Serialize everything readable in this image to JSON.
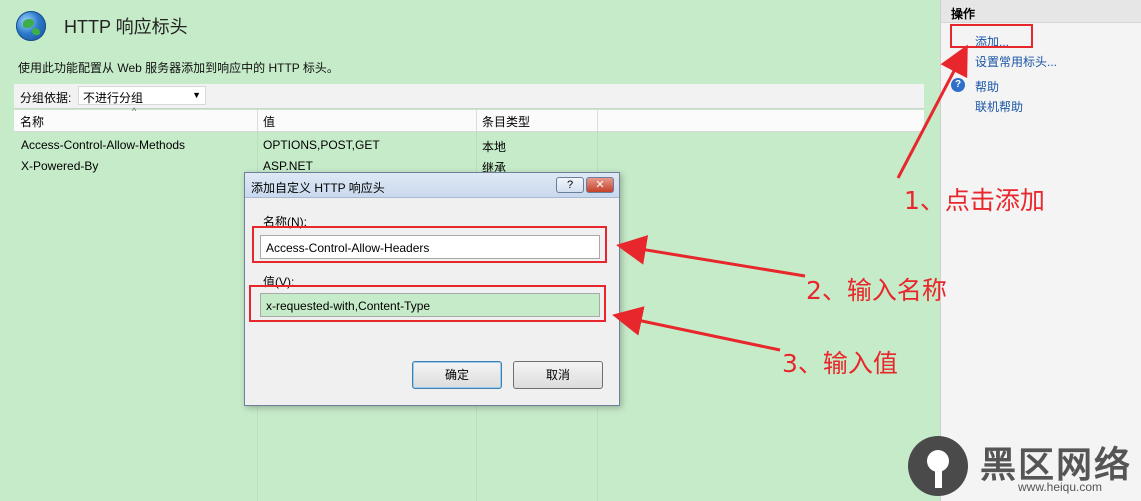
{
  "page": {
    "title": "HTTP 响应标头",
    "description": "使用此功能配置从 Web 服务器添加到响应中的 HTTP 标头。"
  },
  "group": {
    "label": "分组依据:",
    "value": "不进行分组"
  },
  "columns": [
    "名称",
    "值",
    "条目类型"
  ],
  "rows": [
    {
      "name": "Access-Control-Allow-Methods",
      "value": "OPTIONS,POST,GET",
      "type": "本地"
    },
    {
      "name": "X-Powered-By",
      "value": "ASP.NET",
      "type": "继承"
    }
  ],
  "sidebar": {
    "header": "操作",
    "add": "添加...",
    "common": "设置常用标头...",
    "help": "帮助",
    "online_help": "联机帮助"
  },
  "dialog": {
    "title": "添加自定义 HTTP 响应头",
    "help_btn": "?",
    "close_btn": "✕",
    "name_label": "名称(N):",
    "name_value": "Access-Control-Allow-Headers",
    "value_label": "值(V):",
    "value_value": "x-requested-with,Content-Type",
    "ok": "确定",
    "cancel": "取消"
  },
  "annotations": {
    "step1": "1、点击添加",
    "step2": "2、输入名称",
    "step3": "3、输入值"
  },
  "watermark": {
    "text": "黑区网络",
    "url": "www.heiqu.com"
  },
  "colors": {
    "main_bg": "#c6ebc9",
    "annotation_red": "#e8272c",
    "link_blue": "#1a55a6"
  }
}
